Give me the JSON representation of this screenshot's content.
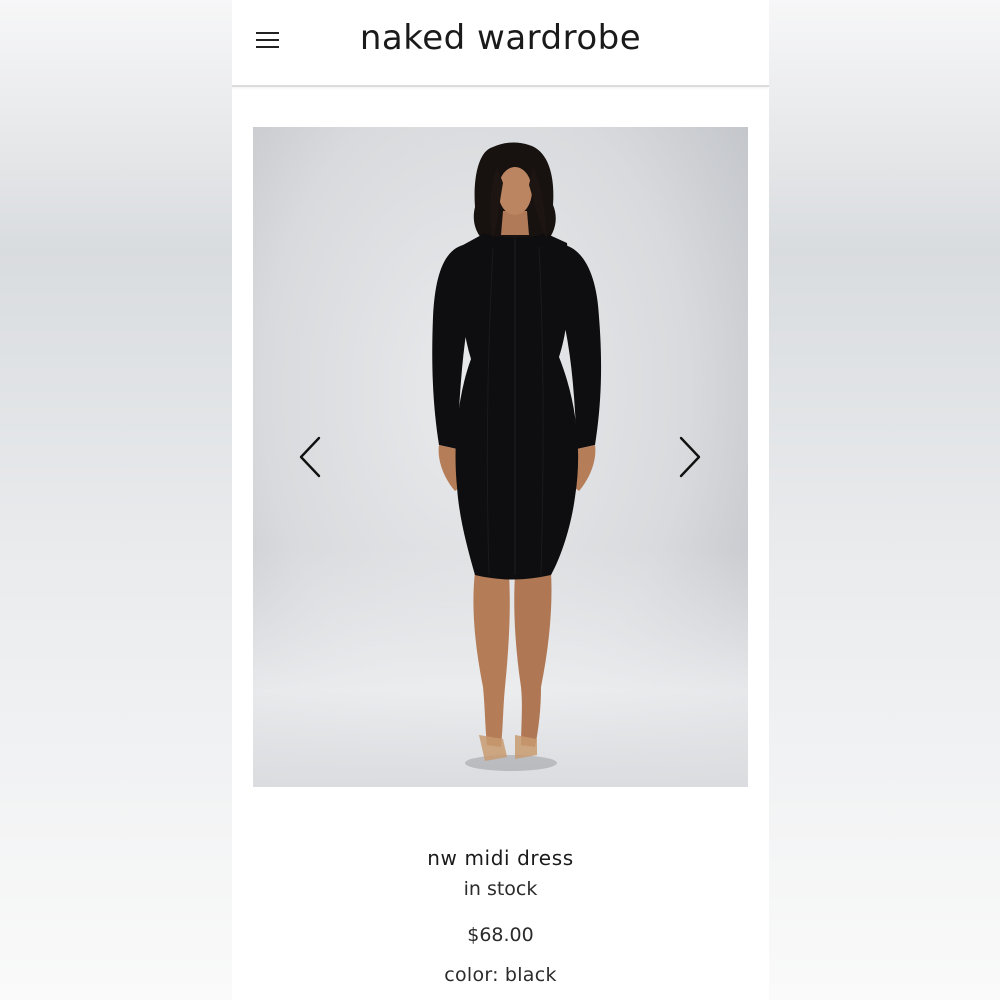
{
  "header": {
    "brand": "naked wardrobe",
    "menu_icon": "hamburger-menu-icon"
  },
  "gallery": {
    "image_alt": "model wearing black long sleeve midi dress",
    "prev_icon": "chevron-left-icon",
    "next_icon": "chevron-right-icon"
  },
  "product": {
    "name": "nw midi dress",
    "availability": "in stock",
    "price": "$68.00",
    "color_label": "color:",
    "color_value": "black"
  },
  "colors": {
    "text": "#1a1a1a",
    "dress": "#0e0e10",
    "skin": "#b9825f",
    "backdrop": "#d8dadd"
  }
}
